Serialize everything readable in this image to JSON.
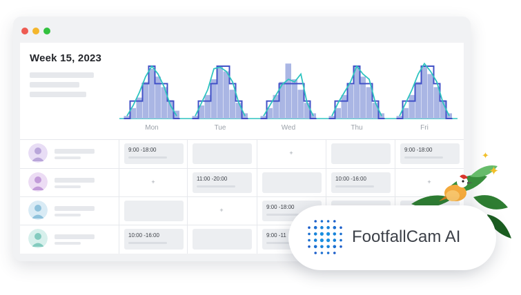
{
  "header": {
    "week_title": "Week 15, 2023"
  },
  "window_controls": [
    "close",
    "minimize",
    "maximize"
  ],
  "colors": {
    "bar_fill": "#aab6e4",
    "staff_line": "#4251c7",
    "traffic_line": "#2ec4c0",
    "shift_box": "#eceef1"
  },
  "chart_data": {
    "type": "bar",
    "categories": [
      "Mon",
      "Tue",
      "Wed",
      "Thu",
      "Fri"
    ],
    "series_note_bars": "hourly footfall",
    "days": [
      {
        "day": "Mon",
        "bars": [
          0.05,
          0.2,
          0.4,
          0.7,
          0.95,
          0.8,
          0.6,
          0.35,
          0.15
        ],
        "staff": [
          0,
          1,
          1,
          2,
          3,
          2,
          2,
          1,
          0
        ],
        "traffic": [
          0.05,
          0.25,
          0.5,
          0.8,
          1.0,
          0.85,
          0.6,
          0.25,
          0.05
        ]
      },
      {
        "day": "Tue",
        "bars": [
          0.05,
          0.25,
          0.45,
          0.75,
          1.0,
          0.9,
          0.55,
          0.3,
          0.1
        ],
        "staff": [
          0,
          1,
          1,
          2,
          3,
          3,
          2,
          1,
          0
        ],
        "traffic": [
          0.05,
          0.3,
          0.55,
          0.95,
          0.98,
          0.9,
          0.7,
          0.3,
          0.05
        ]
      },
      {
        "day": "Wed",
        "bars": [
          0.05,
          0.2,
          0.45,
          0.7,
          1.05,
          0.75,
          0.55,
          0.3,
          0.1
        ],
        "staff": [
          0,
          1,
          1,
          2,
          2,
          2,
          2,
          1,
          0
        ],
        "traffic": [
          0.05,
          0.25,
          0.45,
          0.65,
          0.75,
          0.7,
          0.85,
          0.3,
          0.05
        ]
      },
      {
        "day": "Thu",
        "bars": [
          0.05,
          0.2,
          0.45,
          0.65,
          1.0,
          0.8,
          0.6,
          0.3,
          0.1
        ],
        "staff": [
          0,
          1,
          1,
          2,
          3,
          2,
          2,
          1,
          0
        ],
        "traffic": [
          0.05,
          0.3,
          0.5,
          0.7,
          1.0,
          0.85,
          0.75,
          0.3,
          0.05
        ]
      },
      {
        "day": "Fri",
        "bars": [
          0.05,
          0.2,
          0.45,
          0.7,
          1.0,
          0.85,
          0.6,
          0.35,
          0.1
        ],
        "staff": [
          0,
          1,
          1,
          2,
          3,
          3,
          2,
          1,
          0
        ],
        "traffic": [
          0.05,
          0.3,
          0.55,
          0.85,
          1.05,
          0.9,
          0.7,
          0.3,
          0.05
        ]
      }
    ]
  },
  "schedule": {
    "columns": [
      "Mon",
      "Tue",
      "Wed",
      "Thu",
      "Fri"
    ],
    "rows": [
      {
        "avatar": "avatar-purple",
        "cells": [
          "9:00 -18:00",
          "",
          "+",
          "",
          "9:00 -18:00"
        ]
      },
      {
        "avatar": "avatar-violet",
        "cells": [
          "+",
          "11:00 -20:00",
          "",
          "10:00 -16:00",
          "+"
        ]
      },
      {
        "avatar": "avatar-blue",
        "cells": [
          "",
          "+",
          "9:00 -18:00",
          "",
          ""
        ]
      },
      {
        "avatar": "avatar-teal",
        "cells": [
          "10:00 -16:00",
          "",
          "9:00 -11",
          "",
          ""
        ]
      }
    ]
  },
  "brand": {
    "name": "FootfallCam AI",
    "icon": "dot-grid-logo"
  },
  "decorations": [
    "bird-icon",
    "leaves",
    "sparkle-icon"
  ]
}
